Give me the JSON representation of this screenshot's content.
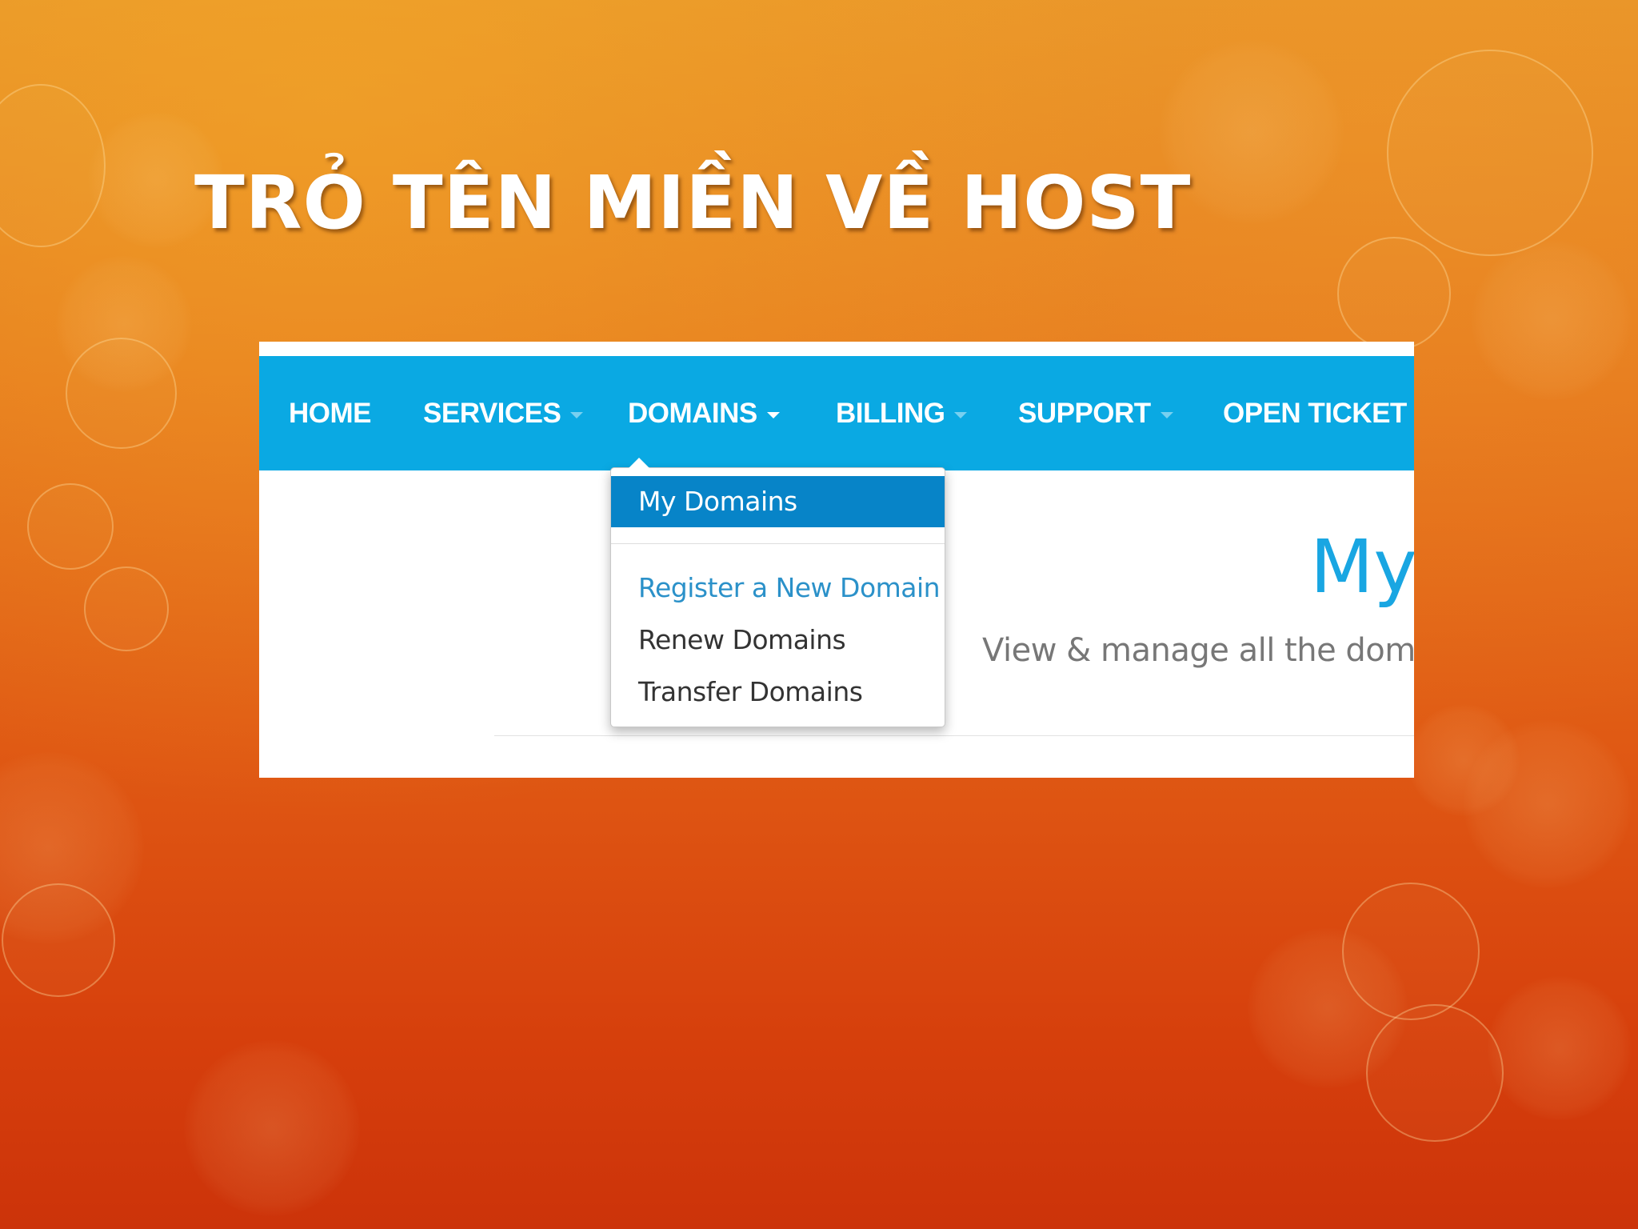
{
  "slide": {
    "title": "TRỎ TÊN MIỀN VỀ HOST"
  },
  "navbar": {
    "items": [
      {
        "label": "HOME",
        "has_caret": false
      },
      {
        "label": "SERVICES",
        "has_caret": true
      },
      {
        "label": "DOMAINS",
        "has_caret": true,
        "active": true
      },
      {
        "label": "BILLING",
        "has_caret": true
      },
      {
        "label": "SUPPORT",
        "has_caret": true
      },
      {
        "label": "OPEN TICKET",
        "has_caret": false
      }
    ]
  },
  "dropdown": {
    "items": [
      {
        "label": "My Domains",
        "state": "selected"
      },
      {
        "label": "Register a New Domain",
        "state": "hover"
      },
      {
        "label": "Renew Domains",
        "state": "normal"
      },
      {
        "label": "Transfer Domains",
        "state": "normal"
      }
    ]
  },
  "content": {
    "heading": "My",
    "subheading": "View & manage all the domain"
  },
  "colors": {
    "navbar": "#0aa9e3",
    "dropdown_selected": "#0784c8",
    "link_hover": "#2b91c9",
    "heading": "#19a6e2",
    "background_top": "#e8962a",
    "background_bottom": "#cc330a"
  }
}
